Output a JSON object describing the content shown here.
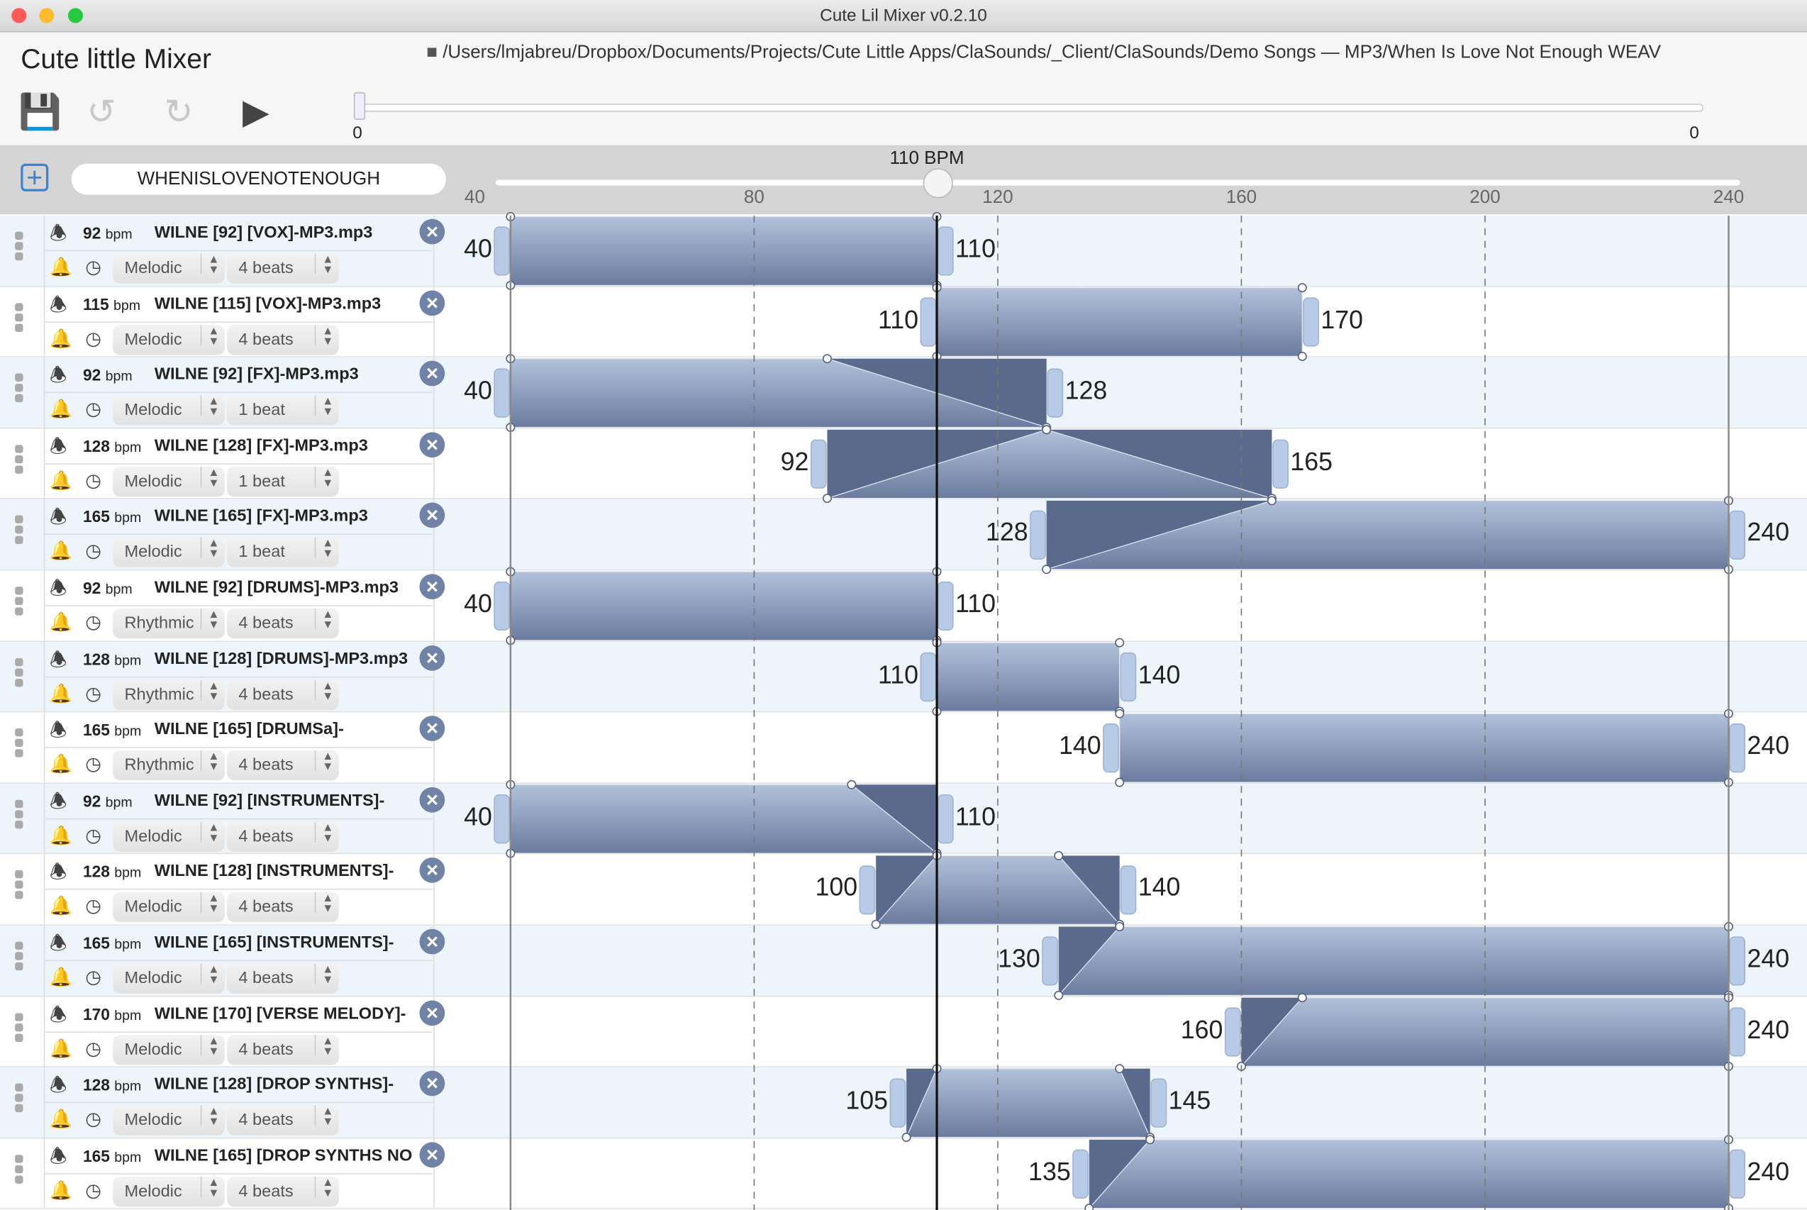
{
  "window": {
    "title": "Cute Lil Mixer v0.2.10"
  },
  "toolbar": {
    "app_title": "Cute little Mixer",
    "path": "/Users/lmjabreu/Dropbox/Documents/Projects/Cute Little Apps/ClaSounds/_Client/ClaSounds/Demo Songs — MP3/When Is Love Not Enough WEAV",
    "seek_start": "0",
    "seek_end": "0",
    "seek_position": 0
  },
  "song": {
    "name": "WHENISLOVENOTENOUGH",
    "bpm_label": "110 BPM",
    "bpm": 110,
    "bpm_min": 40,
    "bpm_max": 240,
    "ticks": [
      "40",
      "80",
      "120",
      "160",
      "200",
      "240"
    ]
  },
  "colors": {
    "bar_dark": "#5a6a8c",
    "bar_light": "#a8b8d4",
    "knob": "#b8cbe6",
    "accent": "#3b82d0"
  },
  "bpm_unit": "bpm",
  "tracks": [
    {
      "bpm": "92",
      "name": "WILNE [92] [VOX]-MP3.mp3",
      "type": "Melodic",
      "beats": "4 beats",
      "lo": 40,
      "fi": 40,
      "fo": 110,
      "hi": 110,
      "lo_label": "40",
      "hi_label": "110"
    },
    {
      "bpm": "115",
      "name": "WILNE [115] [VOX]-MP3.mp3",
      "type": "Melodic",
      "beats": "4 beats",
      "lo": 110,
      "fi": 110,
      "fo": 170,
      "hi": 170,
      "lo_label": "110",
      "hi_label": "170"
    },
    {
      "bpm": "92",
      "name": "WILNE [92] [FX]-MP3.mp3",
      "type": "Melodic",
      "beats": "1 beat",
      "lo": 40,
      "fi": 40,
      "fo": 92,
      "hi": 128,
      "lo_label": "40",
      "hi_label": "128"
    },
    {
      "bpm": "128",
      "name": "WILNE [128] [FX]-MP3.mp3",
      "type": "Melodic",
      "beats": "1 beat",
      "lo": 92,
      "fi": 128,
      "fo": 128,
      "hi": 165,
      "lo_label": "92",
      "hi_label": "165"
    },
    {
      "bpm": "165",
      "name": "WILNE [165] [FX]-MP3.mp3",
      "type": "Melodic",
      "beats": "1 beat",
      "lo": 128,
      "fi": 165,
      "fo": 240,
      "hi": 240,
      "lo_label": "128",
      "hi_label": "240"
    },
    {
      "bpm": "92",
      "name": "WILNE [92] [DRUMS]-MP3.mp3",
      "type": "Rhythmic",
      "beats": "4 beats",
      "lo": 40,
      "fi": 40,
      "fo": 110,
      "hi": 110,
      "lo_label": "40",
      "hi_label": "110"
    },
    {
      "bpm": "128",
      "name": "WILNE [128] [DRUMS]-MP3.mp3",
      "type": "Rhythmic",
      "beats": "4 beats",
      "lo": 110,
      "fi": 110,
      "fo": 140,
      "hi": 140,
      "lo_label": "110",
      "hi_label": "140"
    },
    {
      "bpm": "165",
      "name": "WILNE [165] [DRUMSa]-",
      "type": "Rhythmic",
      "beats": "4 beats",
      "lo": 140,
      "fi": 140,
      "fo": 240,
      "hi": 240,
      "lo_label": "140",
      "hi_label": "240"
    },
    {
      "bpm": "92",
      "name": "WILNE [92] [INSTRUMENTS]-",
      "type": "Melodic",
      "beats": "4 beats",
      "lo": 40,
      "fi": 40,
      "fo": 96,
      "hi": 110,
      "lo_label": "40",
      "hi_label": "110"
    },
    {
      "bpm": "128",
      "name": "WILNE [128] [INSTRUMENTS]-",
      "type": "Melodic",
      "beats": "4 beats",
      "lo": 100,
      "fi": 110,
      "fo": 130,
      "hi": 140,
      "lo_label": "100",
      "hi_label": "140"
    },
    {
      "bpm": "165",
      "name": "WILNE [165] [INSTRUMENTS]-",
      "type": "Melodic",
      "beats": "4 beats",
      "lo": 130,
      "fi": 140,
      "fo": 240,
      "hi": 240,
      "lo_label": "130",
      "hi_label": "240"
    },
    {
      "bpm": "170",
      "name": "WILNE [170] [VERSE MELODY]-",
      "type": "Melodic",
      "beats": "4 beats",
      "lo": 160,
      "fi": 170,
      "fo": 240,
      "hi": 240,
      "lo_label": "160",
      "hi_label": "240"
    },
    {
      "bpm": "128",
      "name": "WILNE [128] [DROP SYNTHS]-",
      "type": "Melodic",
      "beats": "4 beats",
      "lo": 105,
      "fi": 110,
      "fo": 140,
      "hi": 145,
      "lo_label": "105",
      "hi_label": "145"
    },
    {
      "bpm": "165",
      "name": "WILNE [165] [DROP SYNTHS NO",
      "type": "Melodic",
      "beats": "4 beats",
      "lo": 135,
      "fi": 145,
      "fo": 240,
      "hi": 240,
      "lo_label": "135",
      "hi_label": "240"
    }
  ]
}
